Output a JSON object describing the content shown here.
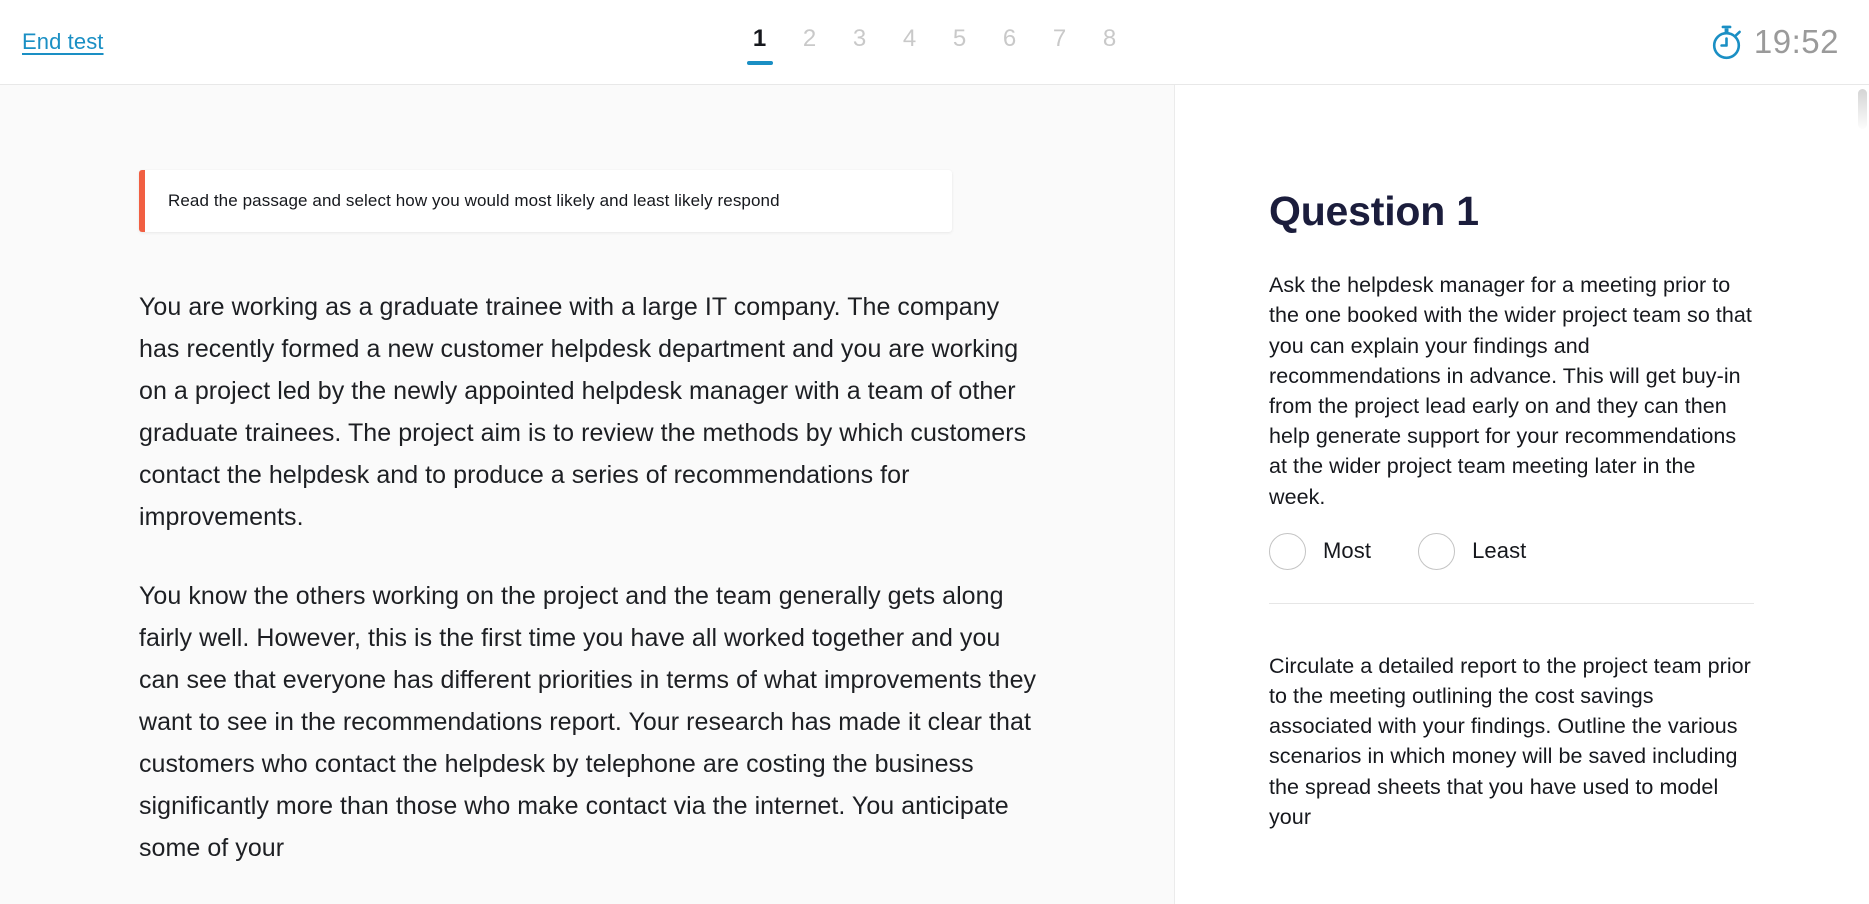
{
  "header": {
    "end_test_label": "End test",
    "pagination": {
      "pages": [
        "1",
        "2",
        "3",
        "4",
        "5",
        "6",
        "7",
        "8"
      ],
      "active_index": 0
    },
    "timer": {
      "icon": "stopwatch-icon",
      "value": "19:52",
      "icon_color": "#1a8fc4",
      "text_color": "#9a9a9a"
    },
    "accent_color": "#1a8fc4"
  },
  "passage": {
    "instruction": {
      "text": "Read the passage and select how you would most likely and least likely respond",
      "accent_color": "#f15f42"
    },
    "paragraphs": [
      "You are working as a graduate trainee with a large IT company. The company has recently formed a new customer helpdesk department and you are working on a project led by the newly appointed helpdesk manager with a team of other graduate trainees. The project aim is to review the methods by which customers contact the helpdesk and to produce a series of recommendations for improvements.",
      "You know the others working on the project and the team generally gets along fairly well. However, this is the first time you have all worked together and you can see that everyone has different priorities in terms of what improvements they want to see in the recommendations report. Your research has made it clear that customers who contact the helpdesk by telephone are costing the business significantly more than those who make contact via the internet. You anticipate some of your"
    ]
  },
  "question": {
    "title": "Question 1",
    "title_color": "#1b1d3c",
    "options": [
      {
        "text": "Ask the helpdesk manager for a meeting prior to the one booked with the wider project team so that you can explain your findings and recommendations in advance. This will get buy-in from the project lead early on and they can then help generate support for your recommendations at the wider project team meeting later in the week.",
        "most_label": "Most",
        "least_label": "Least",
        "most_selected": false,
        "least_selected": false
      },
      {
        "text": "Circulate a detailed report to the project team prior to the meeting outlining the cost savings associated with your findings. Outline the various scenarios in which money will be saved including the spread sheets that you have used to model your"
      }
    ]
  }
}
